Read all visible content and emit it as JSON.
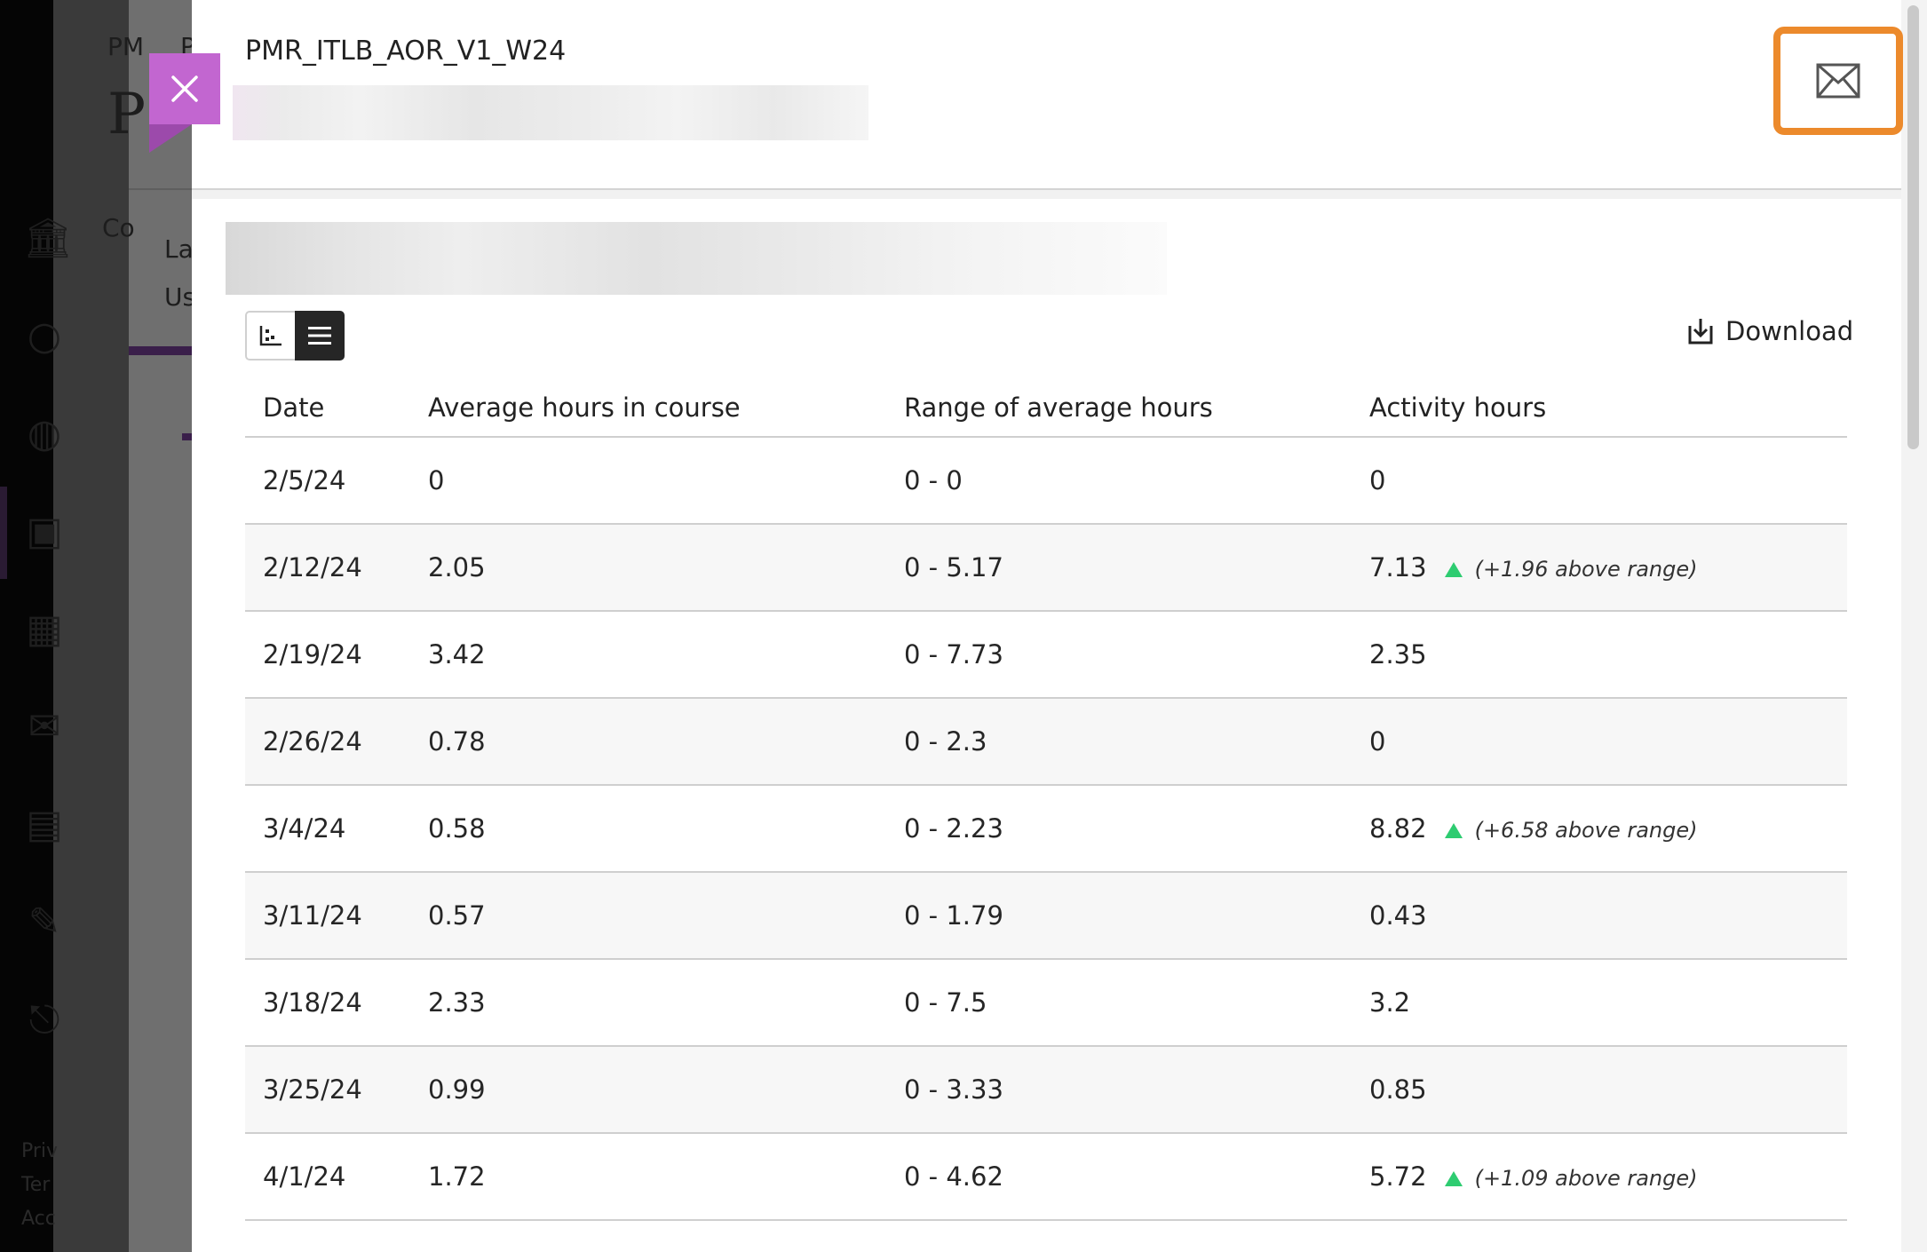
{
  "background": {
    "fragments": [
      "PM",
      "P",
      "P",
      "Co",
      "La",
      "Us"
    ],
    "footer_links": [
      "Priv",
      "Ter",
      "Acc"
    ]
  },
  "panel": {
    "course_code": "PMR_ITLB_AOR_V1_W24",
    "view_toggle": {
      "chart_icon": "scatter-chart-icon",
      "table_icon": "list-icon"
    },
    "download_label": "Download",
    "colors": {
      "close_button": "#c266d0",
      "mail_focus": "#ec8a2c",
      "above_range_marker": "#2ecc71"
    }
  },
  "table": {
    "headers": [
      "Date",
      "Average hours in course",
      "Range of average hours",
      "Activity hours"
    ],
    "rows": [
      {
        "date": "2/5/24",
        "avg": "0",
        "range": "0 - 0",
        "activity": "0",
        "delta": ""
      },
      {
        "date": "2/12/24",
        "avg": "2.05",
        "range": "0 - 5.17",
        "activity": "7.13",
        "delta": "(+1.96 above range)"
      },
      {
        "date": "2/19/24",
        "avg": "3.42",
        "range": "0 - 7.73",
        "activity": "2.35",
        "delta": ""
      },
      {
        "date": "2/26/24",
        "avg": "0.78",
        "range": "0 - 2.3",
        "activity": "0",
        "delta": ""
      },
      {
        "date": "3/4/24",
        "avg": "0.58",
        "range": "0 - 2.23",
        "activity": "8.82",
        "delta": "(+6.58 above range)"
      },
      {
        "date": "3/11/24",
        "avg": "0.57",
        "range": "0 - 1.79",
        "activity": "0.43",
        "delta": ""
      },
      {
        "date": "3/18/24",
        "avg": "2.33",
        "range": "0 - 7.5",
        "activity": "3.2",
        "delta": ""
      },
      {
        "date": "3/25/24",
        "avg": "0.99",
        "range": "0 - 3.33",
        "activity": "0.85",
        "delta": ""
      },
      {
        "date": "4/1/24",
        "avg": "1.72",
        "range": "0 - 4.62",
        "activity": "5.72",
        "delta": "(+1.09 above range)"
      }
    ]
  }
}
